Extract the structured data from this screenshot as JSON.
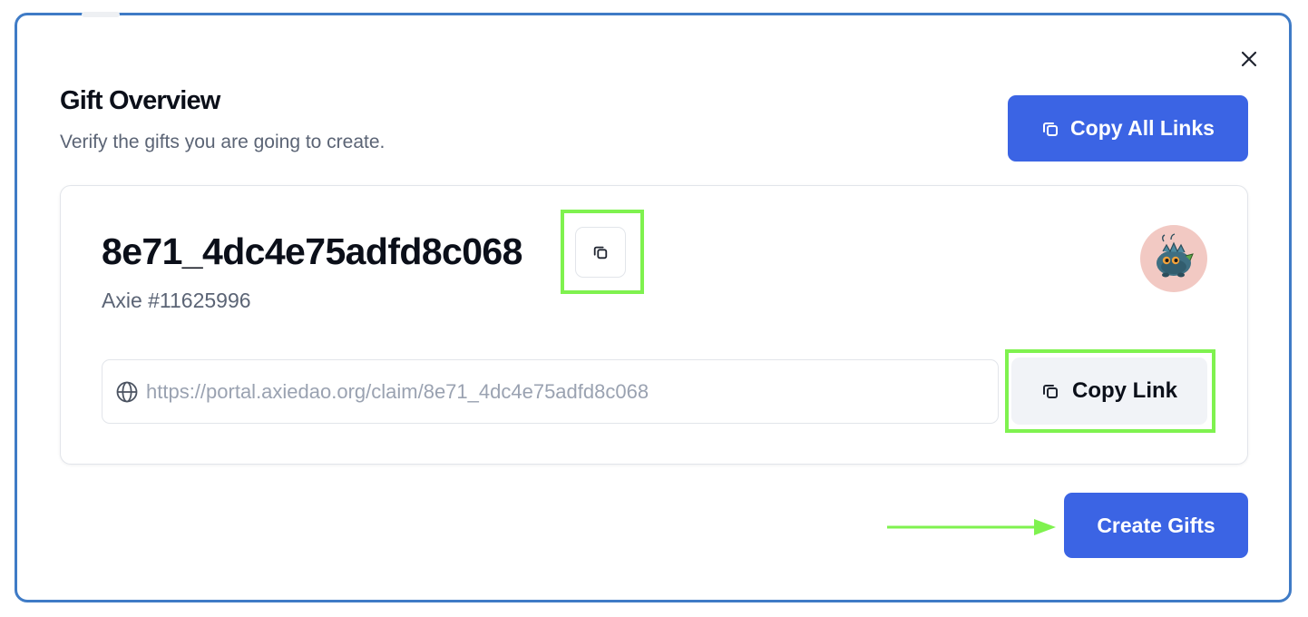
{
  "dialog": {
    "title": "Gift Overview",
    "subtitle": "Verify the gifts you are going to create.",
    "close_icon": "close-icon",
    "copy_all_label": "Copy All Links",
    "create_label": "Create Gifts"
  },
  "gift": {
    "code": "8e71_4dc4e75adfd8c068",
    "axie": "Axie #11625996",
    "url": "https://portal.axiedao.org/claim/8e71_4dc4e75adfd8c068",
    "copy_link_label": "Copy Link",
    "copy_code_icon": "copy-icon",
    "url_icon": "globe-icon",
    "avatar": "axie-avatar"
  },
  "annotations": {
    "highlight_color": "#7ff24f",
    "arrow_color": "#7ff24f"
  },
  "colors": {
    "primary": "#3b64e4",
    "frame_border": "#3f7bc6",
    "avatar_bg": "#f2c9c3"
  }
}
